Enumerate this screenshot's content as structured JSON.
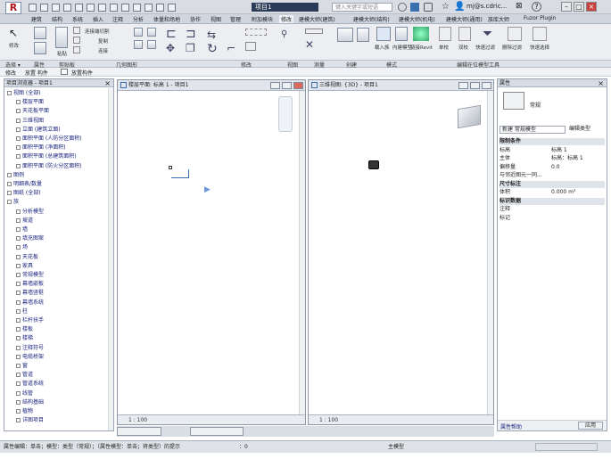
{
  "titlebar": {
    "app_logo": "R",
    "doc_title": "项目1",
    "search_placeholder": "键入关键字或短语",
    "user": "mj@s.cdric...",
    "help": "?"
  },
  "menu_tabs": [
    "建筑",
    "结构",
    "系统",
    "插入",
    "注释",
    "分析",
    "体量和场地",
    "协作",
    "视图",
    "管理",
    "附加模块",
    "修改",
    "建模大师(建筑)",
    "建模大师(结构)",
    "建模大师(机电)",
    "建模大师(通用)",
    "族库大师",
    "Fuzor Plugin"
  ],
  "ribbon": {
    "modify_label": "修改",
    "buttons": [
      "粘贴",
      "剪切",
      "连接端切割",
      "复制",
      "连接",
      "对齐",
      "偏移",
      "镜像",
      "移动",
      "旋转",
      "修剪",
      "拆分",
      "阵列",
      "缩放",
      "视图",
      "测量",
      "创建",
      "载入族",
      "内建模型",
      "链接Revit",
      "单校",
      "双校",
      "快速过滤",
      "删除过滤",
      "快速选择"
    ]
  },
  "panels": [
    "选择 ▾",
    "属性",
    "剪贴板",
    "几何图形",
    "修改",
    "视图",
    "测量",
    "创建",
    "模式",
    "编辑在位模型工具"
  ],
  "selbar": {
    "mode": "修改",
    "tools": "放置 构件",
    "hint": "放置构件"
  },
  "browser": {
    "title": "项目浏览器 - 项目1",
    "items": [
      {
        "label": "视图 (全部)",
        "level": 0
      },
      {
        "label": "楼层平面",
        "level": 1
      },
      {
        "label": "天花板平面",
        "level": 1
      },
      {
        "label": "三维视图",
        "level": 1
      },
      {
        "label": "立面 (建筑立面)",
        "level": 1
      },
      {
        "label": "面积平面 (人防分区面积)",
        "level": 1
      },
      {
        "label": "面积平面 (净面积)",
        "level": 1
      },
      {
        "label": "面积平面 (总建筑面积)",
        "level": 1
      },
      {
        "label": "面积平面 (防火分区面积)",
        "level": 1
      },
      {
        "label": "图例",
        "level": 0
      },
      {
        "label": "明细表/数量",
        "level": 0
      },
      {
        "label": "图纸 (全部)",
        "level": 0
      },
      {
        "label": "族",
        "level": 0
      },
      {
        "label": "分析模型",
        "level": 1
      },
      {
        "label": "坡道",
        "level": 1
      },
      {
        "label": "墙",
        "level": 1
      },
      {
        "label": "填充图案",
        "level": 1
      },
      {
        "label": "场",
        "level": 1
      },
      {
        "label": "天花板",
        "level": 1
      },
      {
        "label": "家具",
        "level": 1
      },
      {
        "label": "常规模型",
        "level": 1
      },
      {
        "label": "幕墙嵌板",
        "level": 1
      },
      {
        "label": "幕墙竖梃",
        "level": 1
      },
      {
        "label": "幕墙系统",
        "level": 1
      },
      {
        "label": "柱",
        "level": 1
      },
      {
        "label": "栏杆扶手",
        "level": 1
      },
      {
        "label": "楼板",
        "level": 1
      },
      {
        "label": "楼梯",
        "level": 1
      },
      {
        "label": "注释符号",
        "level": 1
      },
      {
        "label": "电缆桥架",
        "level": 1
      },
      {
        "label": "窗",
        "level": 1
      },
      {
        "label": "管道",
        "level": 1
      },
      {
        "label": "管道系统",
        "level": 1
      },
      {
        "label": "线管",
        "level": 1
      },
      {
        "label": "结构基础",
        "level": 1
      },
      {
        "label": "植物",
        "level": 1
      },
      {
        "label": "详图项目",
        "level": 1
      }
    ]
  },
  "view_a": {
    "title": "楼层平面: 标高 1 - 项目1",
    "scale": "1 : 100"
  },
  "view_b": {
    "title": "三维视图: {3D} - 项目1",
    "scale": "1 : 100"
  },
  "properties": {
    "title": "属性",
    "type_name": "常规",
    "category_dropdown": "新建 常规模型",
    "edit_type": "编辑类型",
    "rows": [
      {
        "k": "限制条件",
        "v": "",
        "section": true
      },
      {
        "k": "标高",
        "v": "标高 1"
      },
      {
        "k": "主体",
        "v": "标高：标高 1"
      },
      {
        "k": "偏移量",
        "v": "0.0"
      },
      {
        "k": "与邻近图元一同...",
        "v": ""
      },
      {
        "k": "尺寸标注",
        "v": "",
        "section": true
      },
      {
        "k": "体积",
        "v": "0.000 m³"
      },
      {
        "k": "标识数据",
        "v": "",
        "section": true
      },
      {
        "k": "注释",
        "v": ""
      },
      {
        "k": "标记",
        "v": ""
      }
    ],
    "help_link": "属性帮助",
    "apply": "应用"
  },
  "status": {
    "text": "属性编辑：单击；模型：类型（常规）；（属性模型：单击；将类型）的提示",
    "coords": "：0",
    "model": "主模型"
  }
}
